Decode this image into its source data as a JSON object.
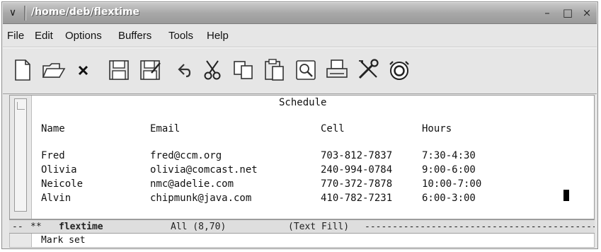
{
  "window": {
    "title": "/home/deb/flextime",
    "menu_glyph": "∨",
    "minimize": "–",
    "maximize": "□",
    "close": "×"
  },
  "menubar": [
    "File",
    "Edit",
    "Options",
    "Buffers",
    "Tools",
    "Help"
  ],
  "toolbar": [
    {
      "name": "new-file-icon"
    },
    {
      "name": "open-folder-icon"
    },
    {
      "name": "close-buffer-icon"
    },
    {
      "name": "save-icon"
    },
    {
      "name": "save-as-icon"
    },
    {
      "name": "undo-icon"
    },
    {
      "name": "cut-icon"
    },
    {
      "name": "copy-icon"
    },
    {
      "name": "paste-icon"
    },
    {
      "name": "search-icon"
    },
    {
      "name": "print-icon"
    },
    {
      "name": "customize-icon"
    },
    {
      "name": "help-icon"
    }
  ],
  "buffer": {
    "heading": "Schedule",
    "columns": [
      "Name",
      "Email",
      "Cell",
      "Hours"
    ],
    "rows": [
      [
        "Fred",
        "fred@ccm.org",
        "703-812-7837",
        "7:30-4:30"
      ],
      [
        "Olivia",
        "olivia@comcast.net",
        "240-994-0784",
        "9:00-6:00"
      ],
      [
        "Neicole",
        "nmc@adelie.com",
        "770-372-7878",
        "10:00-7:00"
      ],
      [
        "Alvin",
        "chipmunk@java.com",
        "410-782-7231",
        "6:00-3:00"
      ]
    ]
  },
  "modeline": {
    "prefix": "--",
    "modified": "**",
    "buffer_name": "flextime",
    "position": "All (8,70)",
    "mode": "(Text Fill)",
    "fill": "------------------------------------------------------"
  },
  "minibuffer": {
    "message": "Mark set"
  },
  "colors": {
    "titlebar": "#a8a8a8",
    "chrome": "#e6e6e6",
    "buffer_bg": "#ffffff"
  }
}
